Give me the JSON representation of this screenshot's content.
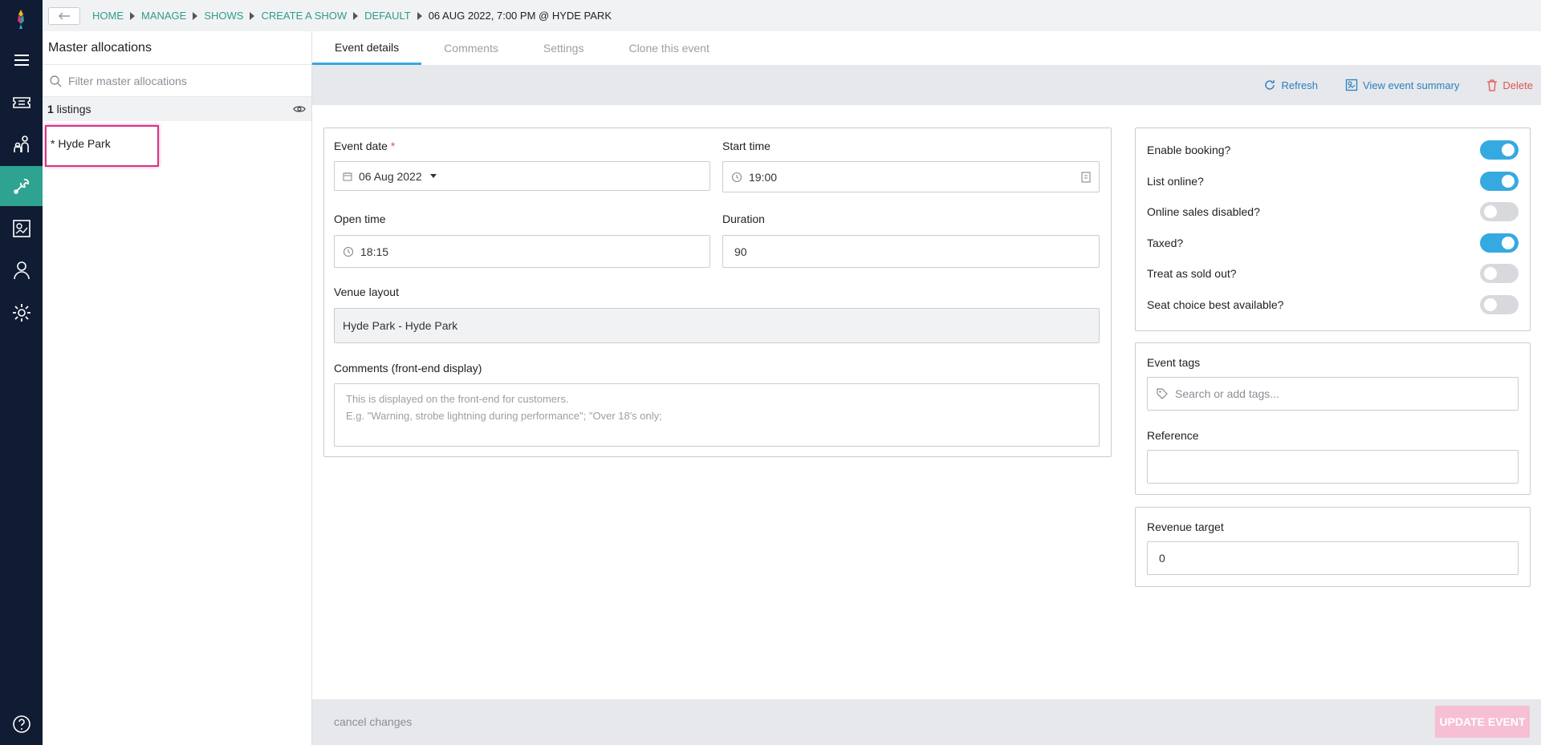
{
  "nav": {
    "items": [
      "menu-icon",
      "tickets-icon",
      "audience-icon",
      "tools-icon",
      "reports-icon",
      "user-icon",
      "settings-icon"
    ],
    "active": "tools-icon",
    "help_icon": "help-icon"
  },
  "breadcrumb": [
    "HOME",
    "MANAGE",
    "SHOWS",
    "CREATE A SHOW",
    "DEFAULT",
    "06 AUG 2022, 7:00 PM @ HYDE PARK"
  ],
  "master": {
    "title": "Master allocations",
    "filter_placeholder": "Filter master allocations",
    "listings_count": "1",
    "listings_label": " listings",
    "item": "* Hyde Park"
  },
  "tabs": [
    "Event details",
    "Comments",
    "Settings",
    "Clone this event"
  ],
  "actions": {
    "refresh": "Refresh",
    "summary": "View event summary",
    "delete": "Delete"
  },
  "form": {
    "event_date_label": "Event date",
    "required_mark": " *",
    "event_date_value": "06 Aug 2022",
    "start_time_label": "Start time",
    "start_time_value": "19:00",
    "open_time_label": "Open time",
    "open_time_value": "18:15",
    "duration_label": "Duration",
    "duration_value": "90",
    "venue_label": "Venue layout",
    "venue_value": "Hyde Park - Hyde Park",
    "comments_label": "Comments (front-end display)",
    "comments_placeholder_line1": "This is displayed on the front-end for customers.",
    "comments_placeholder_line2": "E.g. \"Warning, strobe lightning during performance\"; \"Over 18's only;"
  },
  "toggles": [
    {
      "label": "Enable booking?",
      "on": true
    },
    {
      "label": "List online?",
      "on": true
    },
    {
      "label": "Online sales disabled?",
      "on": false
    },
    {
      "label": "Taxed?",
      "on": true
    },
    {
      "label": "Treat as sold out?",
      "on": false
    },
    {
      "label": "Seat choice best available?",
      "on": false
    }
  ],
  "tags": {
    "label": "Event tags",
    "placeholder": "Search or add tags...",
    "reference_label": "Reference",
    "reference_value": ""
  },
  "revenue": {
    "label": "Revenue target",
    "value": "0"
  },
  "footer": {
    "cancel": "cancel changes",
    "update": "UPDATE EVENT"
  },
  "colors": {
    "rail": "#0f1c33",
    "active_nav": "#2fa391",
    "toggle_on": "#36a9e1",
    "link": "#2b7fc1",
    "delete": "#e05454",
    "highlight": "#d63384",
    "update_btn": "#f6bfd3"
  }
}
